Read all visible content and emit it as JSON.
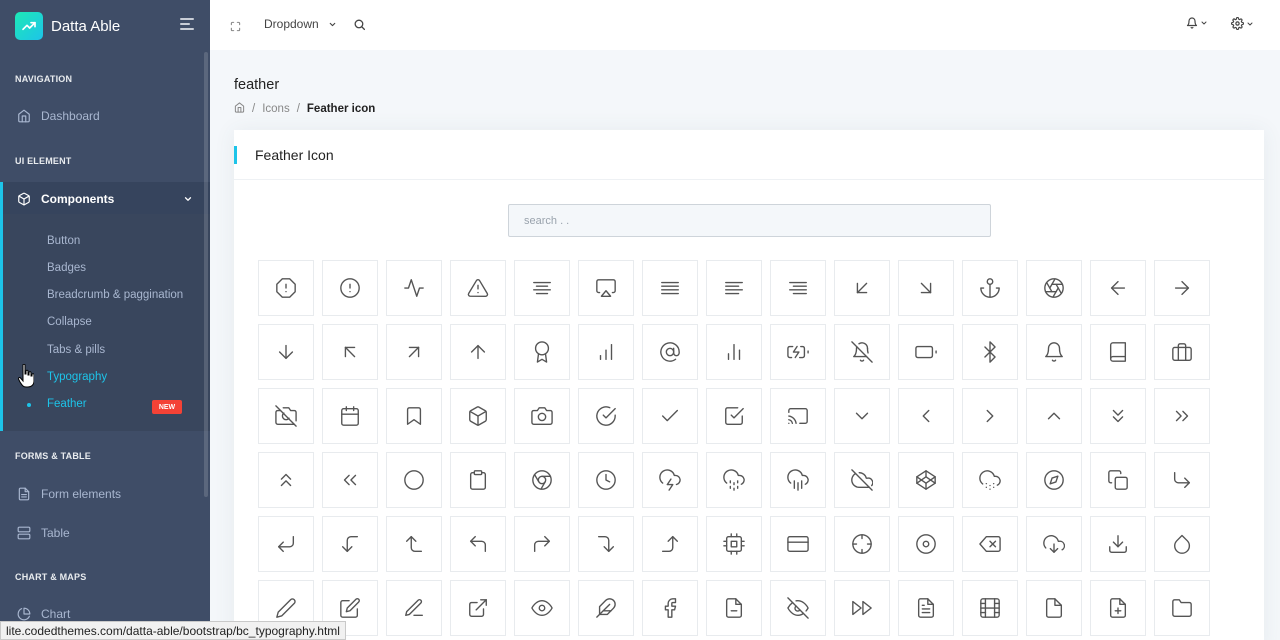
{
  "brand": {
    "name": "Datta Able"
  },
  "header": {
    "dropdown_label": "Dropdown"
  },
  "nav": {
    "sections": [
      {
        "label": "NAVIGATION"
      },
      {
        "label": "UI ELEMENT"
      },
      {
        "label": "FORMS & TABLE"
      },
      {
        "label": "CHART & MAPS"
      }
    ],
    "dashboard": "Dashboard",
    "components": "Components",
    "submenu": [
      "Button",
      "Badges",
      "Breadcrumb & paggination",
      "Collapse",
      "Tabs & pills",
      "Typography",
      "Feather"
    ],
    "new_badge": "NEW",
    "form_elements": "Form elements",
    "table": "Table",
    "chart": "Chart"
  },
  "page": {
    "title": "feather",
    "breadcrumb": [
      "Icons",
      "Feather icon"
    ]
  },
  "card": {
    "title": "Feather Icon",
    "search_placeholder": "search . ."
  },
  "icons": [
    "alert-octagon",
    "alert-circle",
    "activity",
    "alert-triangle",
    "align-center",
    "airplay",
    "align-justify",
    "align-left",
    "align-right",
    "arrow-down-left",
    "arrow-down-right",
    "anchor",
    "aperture",
    "arrow-left",
    "arrow-right",
    "arrow-down",
    "arrow-up-left",
    "arrow-up-right",
    "arrow-up",
    "award",
    "bar-chart",
    "at-sign",
    "bar-chart-2",
    "battery-charging",
    "bell-off",
    "battery",
    "bluetooth",
    "bell",
    "book",
    "briefcase",
    "camera-off",
    "calendar",
    "bookmark",
    "box",
    "camera",
    "check-circle",
    "check",
    "check-square",
    "cast",
    "chevron-down",
    "chevron-left",
    "chevron-right",
    "chevron-up",
    "chevrons-down",
    "chevrons-right",
    "chevrons-up",
    "chevrons-left",
    "circle",
    "clipboard",
    "chrome",
    "clock",
    "cloud-lightning",
    "cloud-drizzle",
    "cloud-rain",
    "cloud-off",
    "codepen",
    "cloud-snow",
    "compass",
    "copy",
    "corner-down-right",
    "corner-down-left",
    "corner-left-down",
    "corner-left-up",
    "corner-up-left",
    "corner-up-right",
    "corner-right-down",
    "corner-right-up",
    "cpu",
    "credit-card",
    "crosshair",
    "disc",
    "delete",
    "download-cloud",
    "download",
    "droplet",
    "edit-2",
    "edit",
    "edit-3",
    "external-link",
    "eye",
    "feather",
    "facebook",
    "file-minus",
    "eye-off",
    "fast-forward",
    "file-text",
    "film",
    "file",
    "file-plus",
    "folder"
  ],
  "status_url": "lite.codedthemes.com/datta-able/bootstrap/bc_typography.html",
  "colors": {
    "sidebar": "#3f4d67",
    "accent": "#1dc4e9",
    "badge": "#f44236"
  }
}
